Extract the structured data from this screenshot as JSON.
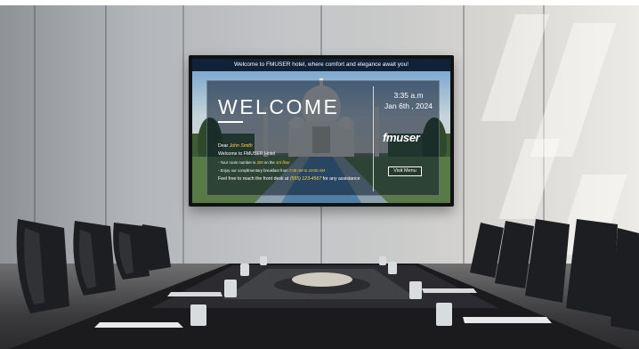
{
  "screen": {
    "banner": "Welcome to FMUSER hotel, where comfort and elegance await you!",
    "title": "WELCOME",
    "greeting_prefix": "Dear ",
    "guest_name": "John Smith",
    "welcome_line": "Welcome to FMUSER Hotel",
    "room_prefix": "- Your room number is ",
    "room_number": "305",
    "room_mid": " on the ",
    "floor": "3rd floor",
    "breakfast_prefix": "- Enjoy our complimentary breakfast from ",
    "breakfast_hours": "7:00 AM to 10:00 AM",
    "contact_prefix": "Feel free to reach the front desk at ",
    "phone": "(555) 123-4567",
    "contact_suffix": " for any assistance",
    "time": "3:35 a.m",
    "date": "Jan 6th , 2024",
    "logo": "fmuser",
    "visit_menu_label": "Visit Menu"
  },
  "colors": {
    "banner_bg": "#0f2238",
    "highlight": "#ffd84a",
    "overlay": "rgba(10,22,40,0.55)"
  }
}
